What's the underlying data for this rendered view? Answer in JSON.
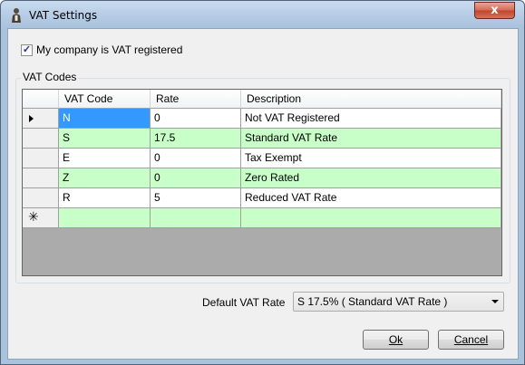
{
  "window": {
    "title": "VAT Settings",
    "close_glyph": "x"
  },
  "settings": {
    "vat_registered_label": "My company is VAT registered",
    "vat_registered_checked": true
  },
  "vat_codes": {
    "group_title": "VAT Codes",
    "columns": [
      "VAT Code",
      "Rate",
      "Description"
    ],
    "rows": [
      {
        "code": "N",
        "rate": "0",
        "description": "Not VAT Registered"
      },
      {
        "code": "S",
        "rate": "17.5",
        "description": "Standard VAT Rate"
      },
      {
        "code": "E",
        "rate": "0",
        "description": "Tax Exempt"
      },
      {
        "code": "Z",
        "rate": "0",
        "description": "Zero Rated"
      },
      {
        "code": "R",
        "rate": "5",
        "description": "Reduced VAT Rate"
      }
    ],
    "new_row_glyph": "✳",
    "current_row_glyph": "▶"
  },
  "default_vat": {
    "label": "Default VAT Rate",
    "value": "S   17.5% ( Standard VAT Rate )"
  },
  "buttons": {
    "ok": "Ok",
    "cancel": "Cancel"
  },
  "colors": {
    "alt_row": "#c8ffc8",
    "selection": "#3399ff"
  },
  "icons": {
    "app": "person-icon",
    "close": "close-icon",
    "dropdown": "chevron-down-icon"
  }
}
